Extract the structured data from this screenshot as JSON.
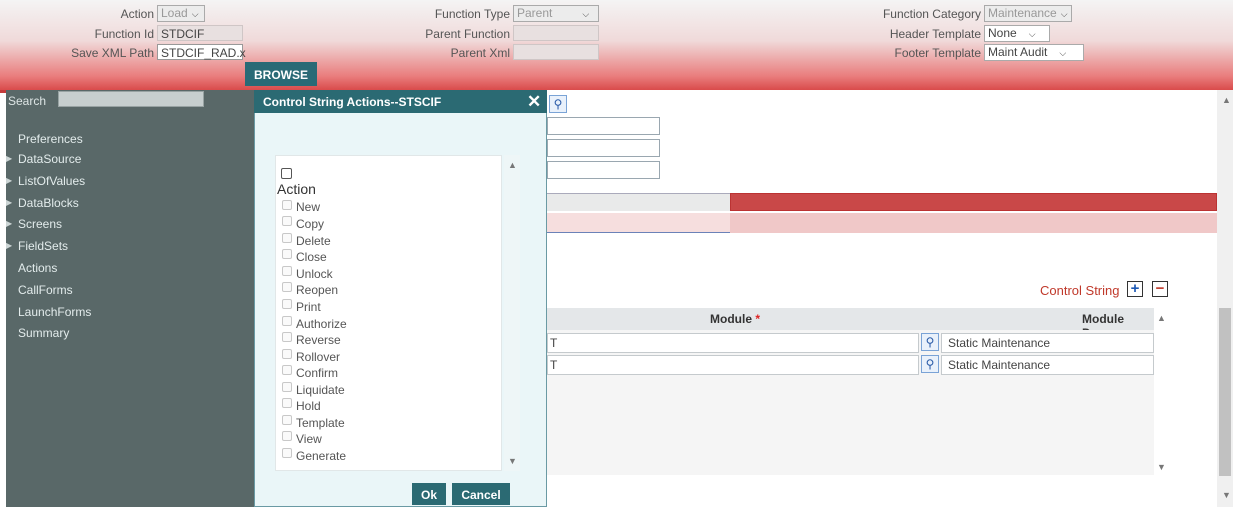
{
  "header": {
    "action_label": "Action",
    "action_value": "Load",
    "function_id_label": "Function Id",
    "function_id_value": "STDCIF",
    "save_xml_label": "Save XML Path",
    "save_xml_value": "STDCIF_RAD.x",
    "browse_label": "BROWSE",
    "function_type_label": "Function Type",
    "function_type_value": "Parent",
    "parent_function_label": "Parent Function",
    "parent_xml_label": "Parent Xml",
    "function_category_label": "Function Category",
    "function_category_value": "Maintenance",
    "header_template_label": "Header Template",
    "header_template_value": "None",
    "footer_template_label": "Footer Template",
    "footer_template_value": "Maint Audit"
  },
  "sidebar": {
    "search_label": "Search",
    "items": [
      {
        "label": "Preferences"
      },
      {
        "label": "DataSource"
      },
      {
        "label": "ListOfValues"
      },
      {
        "label": "DataBlocks"
      },
      {
        "label": "Screens"
      },
      {
        "label": "FieldSets"
      },
      {
        "label": "Actions"
      },
      {
        "label": "CallForms"
      },
      {
        "label": "LaunchForms"
      },
      {
        "label": "Summary"
      }
    ]
  },
  "main": {
    "control_string_label": "Control String",
    "add_glyph": "+",
    "remove_glyph": "−",
    "grid": {
      "col_module": "Module",
      "required_mark": "*",
      "col_module_desc": "Module Desc",
      "rows": [
        {
          "module_tail": "T",
          "desc": "Static Maintenance"
        },
        {
          "module_tail": "T",
          "desc": "Static Maintenance"
        }
      ]
    }
  },
  "dialog": {
    "title": "Control String Actions--STSCIF",
    "close_glyph": "✕",
    "group_label": "Action",
    "items": [
      "New",
      "Copy",
      "Delete",
      "Close",
      "Unlock",
      "Reopen",
      "Print",
      "Authorize",
      "Reverse",
      "Rollover",
      "Confirm",
      "Liquidate",
      "Hold",
      "Template",
      "View",
      "Generate"
    ],
    "ok_label": "Ok",
    "cancel_label": "Cancel"
  },
  "colors": {
    "accent": "#2b6a73",
    "header_red": "#d94b4b",
    "sidebar_bg": "#596868"
  }
}
